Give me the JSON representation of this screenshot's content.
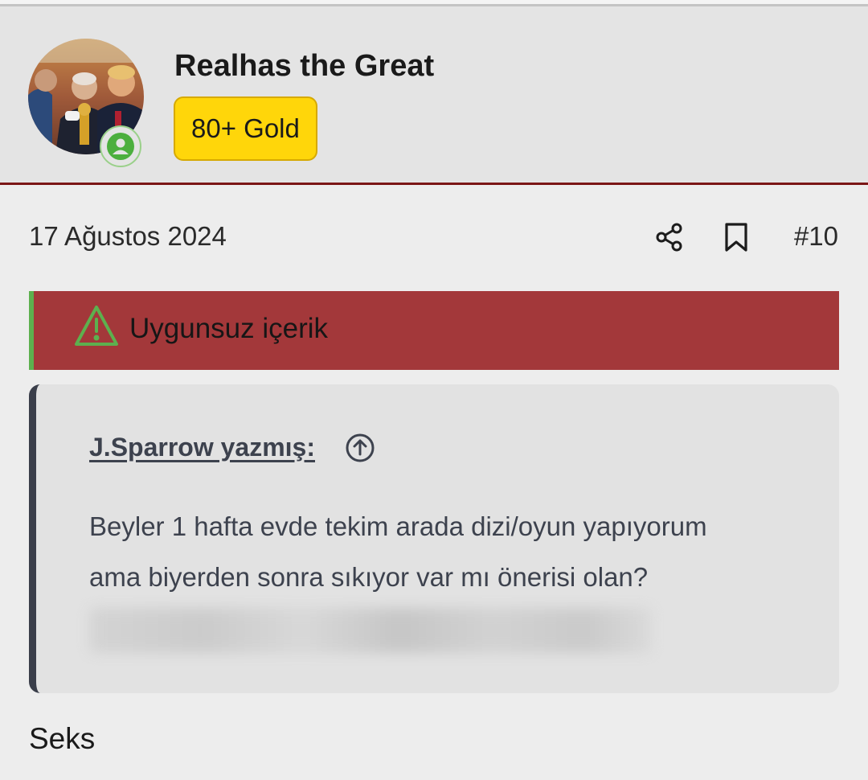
{
  "user": {
    "name": "Realhas the Great",
    "rank": "80+ Gold",
    "status_color": "#4caf3e"
  },
  "post": {
    "date": "17 Ağustos 2024",
    "number": "#10",
    "actions": [
      "share-icon",
      "bookmark-icon"
    ],
    "warning": {
      "text": "Uygunsuz içerik",
      "icon": "warning-triangle-icon",
      "background": "#a3383a"
    },
    "quote": {
      "author": "J.Sparrow yazmış:",
      "jump_icon": "arrow-up-circle-icon",
      "lines": [
        "Beyler 1 hafta evde tekim arada dizi/oyun yapıyorum",
        "ama biyerden sonra sıkıyor var mı önerisi olan?"
      ]
    },
    "body": "Seks"
  },
  "colors": {
    "header_border": "#7b1616",
    "badge_gold": "#ffd60a",
    "quote_bar": "#3a3e4a"
  }
}
